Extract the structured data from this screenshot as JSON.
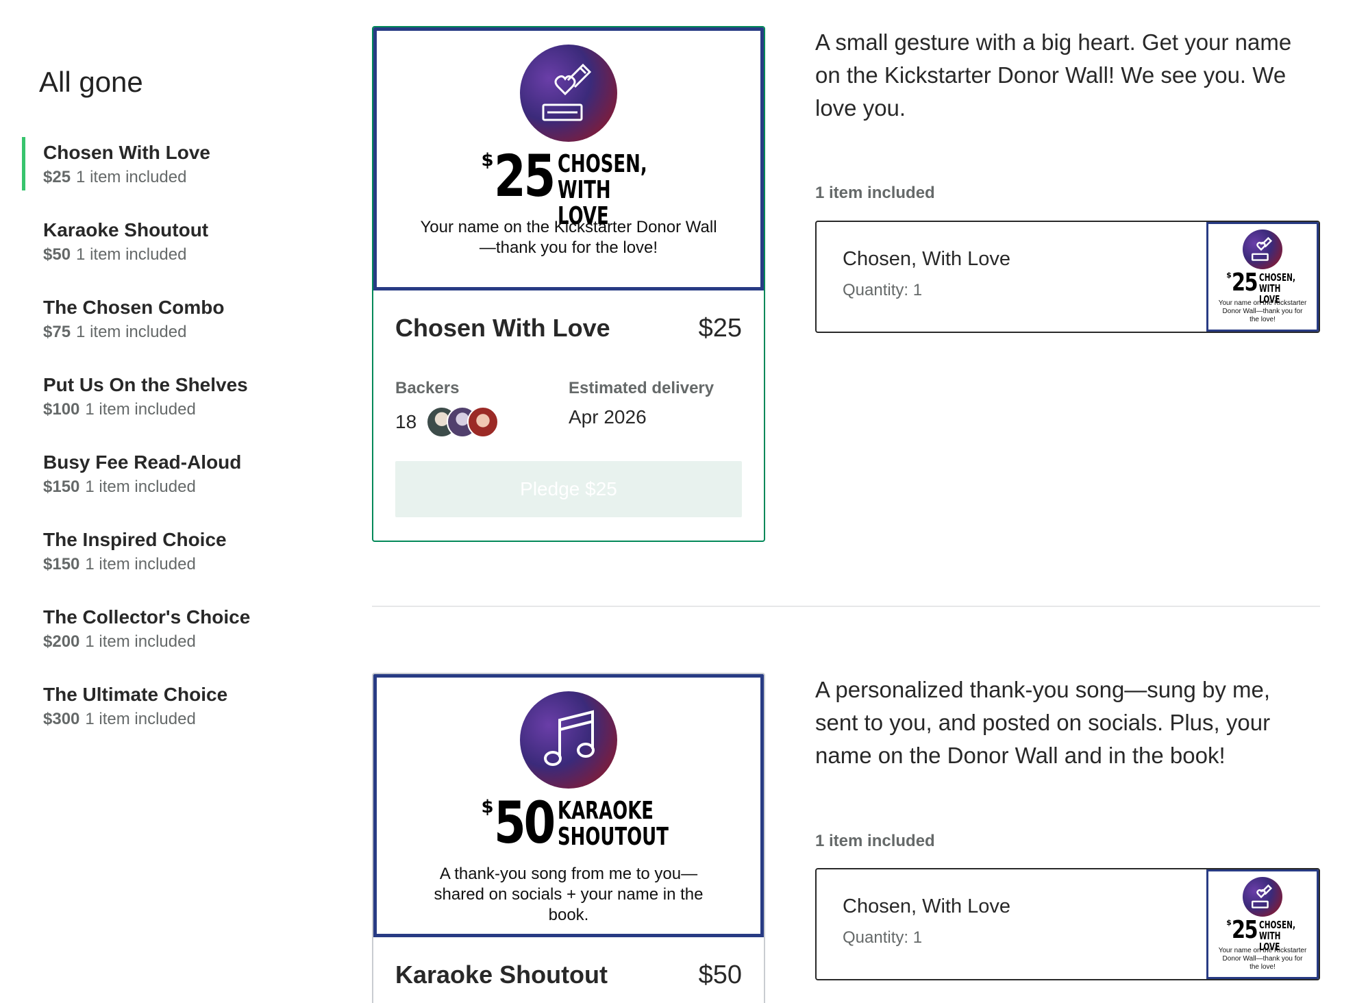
{
  "sidebar": {
    "heading": "All gone",
    "items": [
      {
        "title": "Chosen With Love",
        "price": "$25",
        "count": "1 item included"
      },
      {
        "title": "Karaoke Shoutout",
        "price": "$50",
        "count": "1 item included"
      },
      {
        "title": "The Chosen Combo",
        "price": "$75",
        "count": "1 item included"
      },
      {
        "title": "Put Us On the Shelves",
        "price": "$100",
        "count": "1 item included"
      },
      {
        "title": "Busy Fee Read-Aloud",
        "price": "$150",
        "count": "1 item included"
      },
      {
        "title": "The Inspired Choice",
        "price": "$150",
        "count": "1 item included"
      },
      {
        "title": "The Collector's Choice",
        "price": "$200",
        "count": "1 item included"
      },
      {
        "title": "The Ultimate Choice",
        "price": "$300",
        "count": "1 item included"
      }
    ]
  },
  "rewards": [
    {
      "image": {
        "icon": "heart-in-hand-donation-icon",
        "dollar": "$",
        "amount": "25",
        "name_line1": "CHOSEN,",
        "name_line2": "WITH LOVE",
        "caption": "Your name on the Kickstarter Donor Wall—thank you for the love!"
      },
      "title": "Chosen With Love",
      "price": "$25",
      "backers_label": "Backers",
      "backers_count": "18",
      "delivery_label": "Estimated delivery",
      "delivery_value": "Apr 2026",
      "pledge_label": "Pledge $25",
      "description": "A small gesture with a big heart. Get your name on the Kickstarter Donor Wall! We see you. We love you.",
      "items_label": "1 item included",
      "item": {
        "name": "Chosen, With Love",
        "quantity": "Quantity: 1",
        "thumb_dollar": "$",
        "thumb_amount": "25",
        "thumb_line1": "CHOSEN,",
        "thumb_line2": "WITH LOVE",
        "thumb_caption": "Your name on the Kickstarter Donor Wall—thank you for the love!"
      }
    },
    {
      "image": {
        "icon": "music-note-icon",
        "dollar": "$",
        "amount": "50",
        "name_line1": "KARAOKE",
        "name_line2": "SHOUTOUT",
        "caption": "A thank-you song from me to you—shared on socials + your name in the book."
      },
      "title": "Karaoke Shoutout",
      "price": "$50",
      "description": "A personalized thank-you song—sung by me, sent to you, and posted on socials. Plus, your name on the Donor Wall and in the book!",
      "items_label": "1 item included",
      "item": {
        "name": "Chosen, With Love",
        "quantity": "Quantity: 1",
        "thumb_dollar": "$",
        "thumb_amount": "25",
        "thumb_line1": "CHOSEN,",
        "thumb_line2": "WITH LOVE",
        "thumb_caption": "Your name on the Kickstarter Donor Wall—thank you for the love!"
      }
    }
  ],
  "colors": {
    "accent_green": "#37c46d",
    "card_border": "#028858",
    "image_frame": "#283b84",
    "pledge_disabled_bg": "#e8f2ee"
  }
}
